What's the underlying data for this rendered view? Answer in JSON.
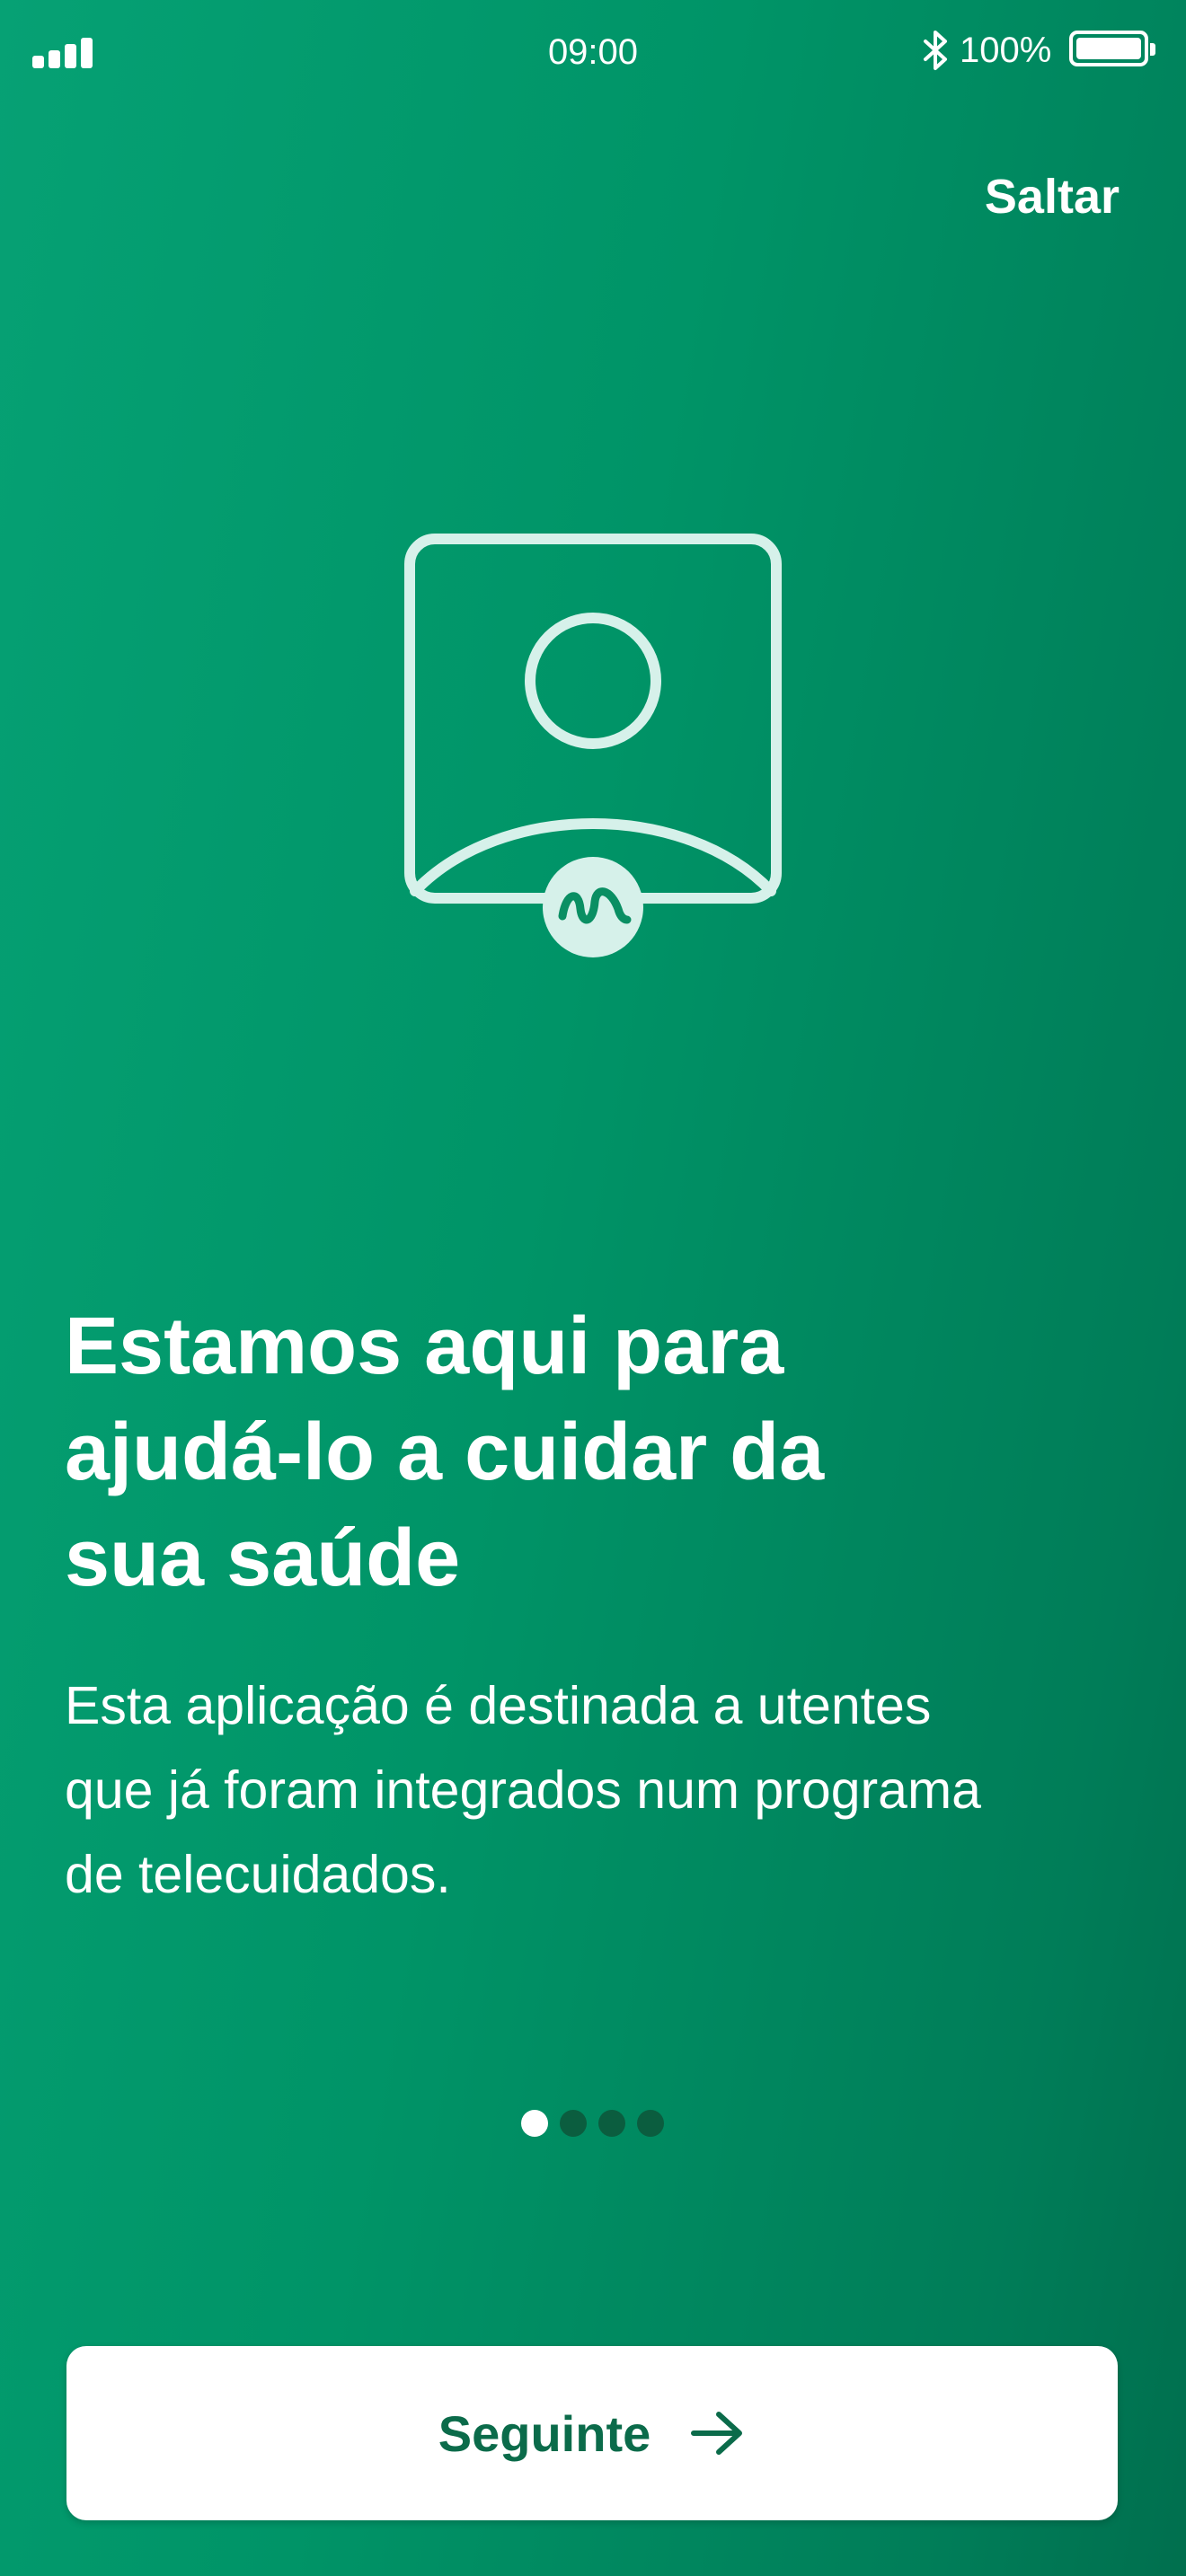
{
  "status_bar": {
    "time": "09:00",
    "battery_percent": "100%",
    "icons": [
      "signal-icon",
      "bluetooth-icon",
      "battery-icon"
    ]
  },
  "header": {
    "skip_label": "Saltar"
  },
  "illustration": {
    "icon": "patient-profile-icon",
    "badge_icon": "brand-m-badge-icon"
  },
  "content": {
    "headline_lines": [
      "Estamos aqui para",
      "ajudá-lo a cuidar da",
      "sua saúde"
    ],
    "body_lines": [
      "Esta aplicação é destinada a utentes",
      "que já foram integrados num programa",
      "de telecuidados."
    ]
  },
  "pager": {
    "total_pages": 4,
    "current_page": 1
  },
  "footer": {
    "next_label": "Seguinte",
    "next_icon": "arrow-right-icon"
  },
  "colors": {
    "background_start": "#06a174",
    "background_end": "#006f4e",
    "button_text": "#0b6b4a",
    "illustration_stroke": "#d6f1ea",
    "dot_inactive": "#0b5d3f"
  }
}
